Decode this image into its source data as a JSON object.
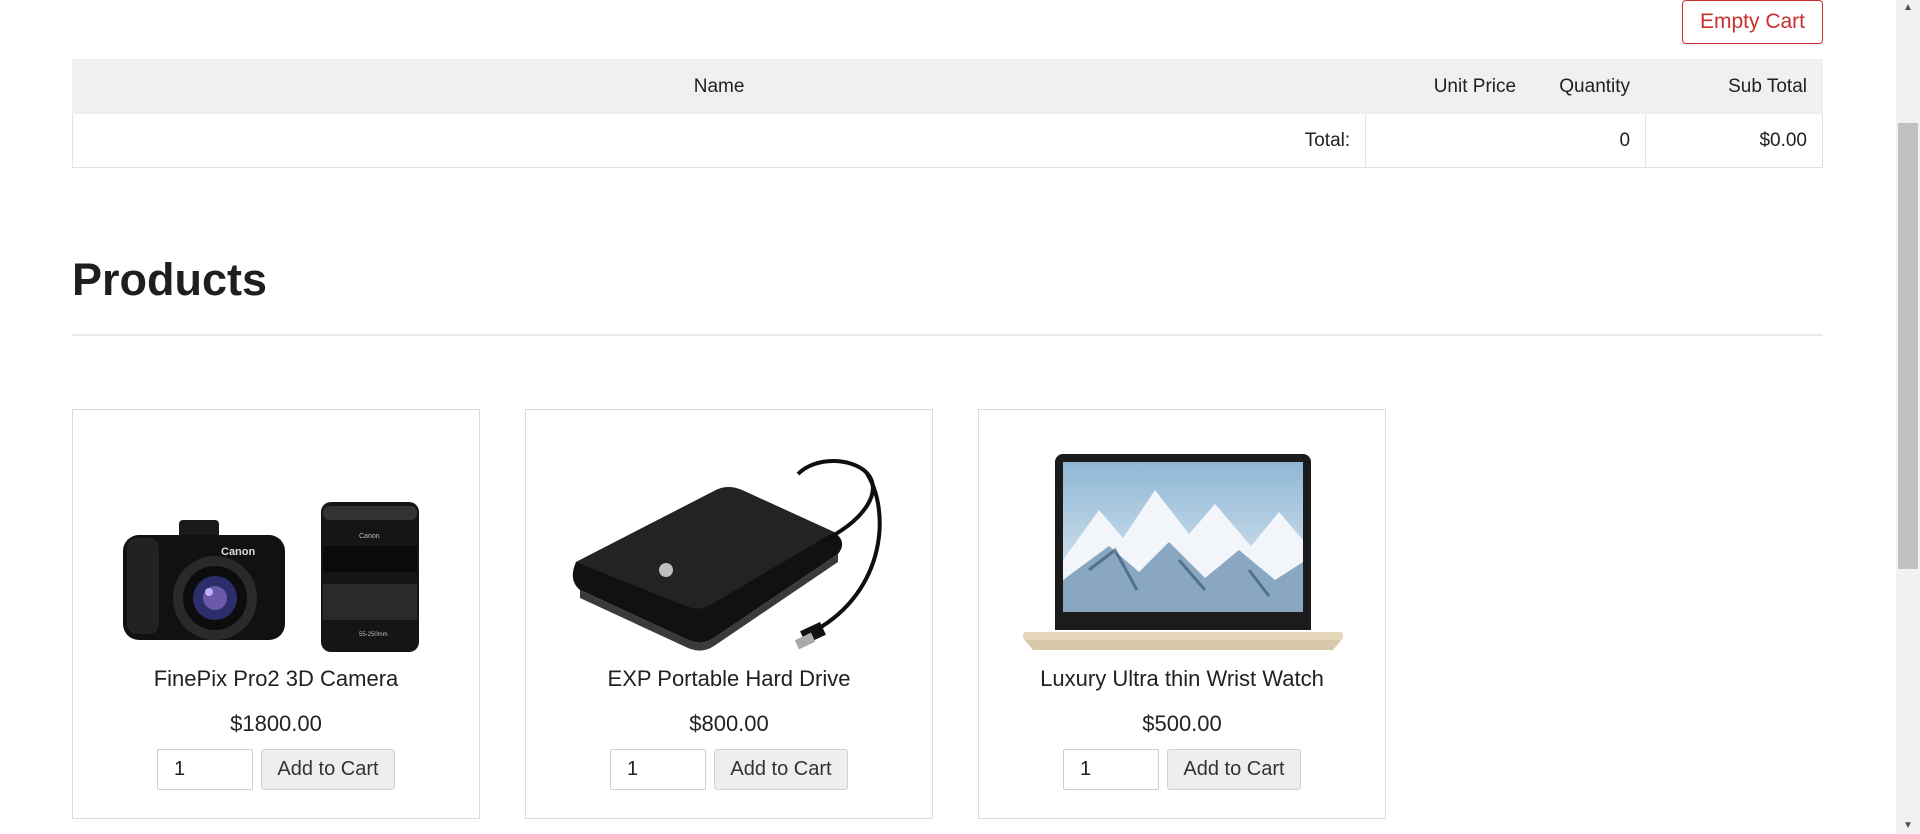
{
  "cart": {
    "empty_button": "Empty Cart",
    "headers": {
      "name": "Name",
      "unit_price": "Unit Price",
      "quantity": "Quantity",
      "sub_total": "Sub Total"
    },
    "total_label": "Total:",
    "total_quantity": "0",
    "total_amount": "$0.00"
  },
  "products": {
    "title": "Products",
    "items": [
      {
        "name": "FinePix Pro2 3D Camera",
        "price": "$1800.00",
        "qty": "1",
        "button": "Add to Cart",
        "icon": "camera-image"
      },
      {
        "name": "EXP Portable Hard Drive",
        "price": "$800.00",
        "qty": "1",
        "button": "Add to Cart",
        "icon": "hard-drive-image"
      },
      {
        "name": "Luxury Ultra thin Wrist Watch",
        "price": "$500.00",
        "qty": "1",
        "button": "Add to Cart",
        "icon": "laptop-image"
      }
    ]
  },
  "colors": {
    "danger": "#c9302c",
    "header_bg": "#f0f0f0",
    "button_bg": "#eeeeee"
  }
}
